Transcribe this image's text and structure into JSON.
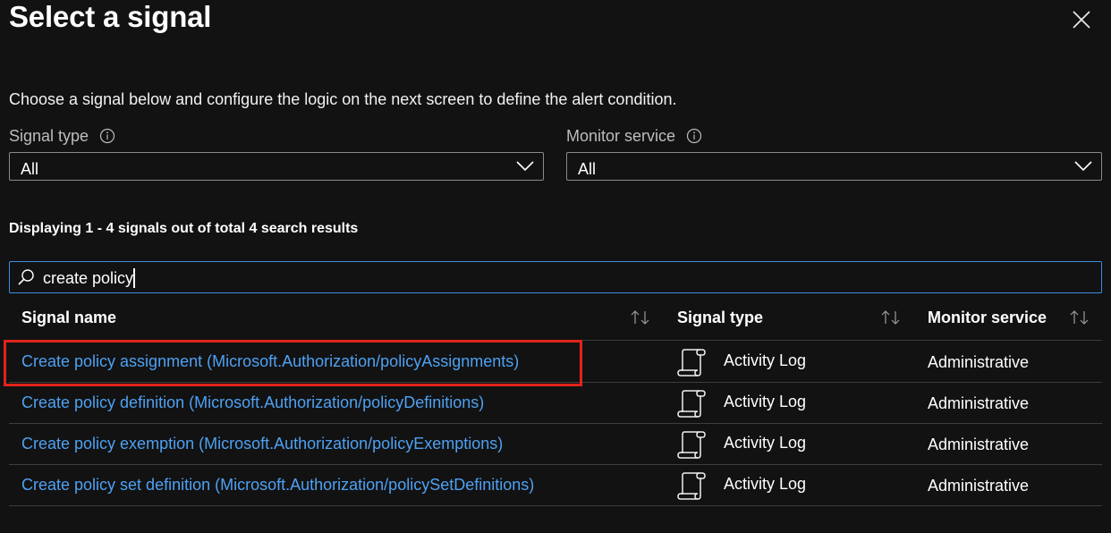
{
  "title": "Select a signal",
  "description": "Choose a signal below and configure the logic on the next screen to define the alert condition.",
  "filters": {
    "signal_type": {
      "label": "Signal type",
      "value": "All"
    },
    "monitor_service": {
      "label": "Monitor service",
      "value": "All"
    }
  },
  "results_count": "Displaying 1 - 4 signals out of total 4 search results",
  "search": {
    "value": "create policy"
  },
  "table": {
    "columns": [
      "Signal name",
      "Signal type",
      "Monitor service"
    ],
    "rows": [
      {
        "name": "Create policy assignment (Microsoft.Authorization/policyAssignments)",
        "type": "Activity Log",
        "service": "Administrative"
      },
      {
        "name": "Create policy definition (Microsoft.Authorization/policyDefinitions)",
        "type": "Activity Log",
        "service": "Administrative"
      },
      {
        "name": "Create policy exemption (Microsoft.Authorization/policyExemptions)",
        "type": "Activity Log",
        "service": "Administrative"
      },
      {
        "name": "Create policy set definition (Microsoft.Authorization/policySetDefinitions)",
        "type": "Activity Log",
        "service": "Administrative"
      }
    ]
  },
  "colors": {
    "background": "#121212",
    "link": "#4ea1f3",
    "focus_border": "#3c8ee0",
    "highlight": "#e0241b"
  },
  "icons": [
    "close-icon",
    "info-icon",
    "chevron-down-icon",
    "search-icon",
    "sort-icon",
    "scroll-icon"
  ]
}
